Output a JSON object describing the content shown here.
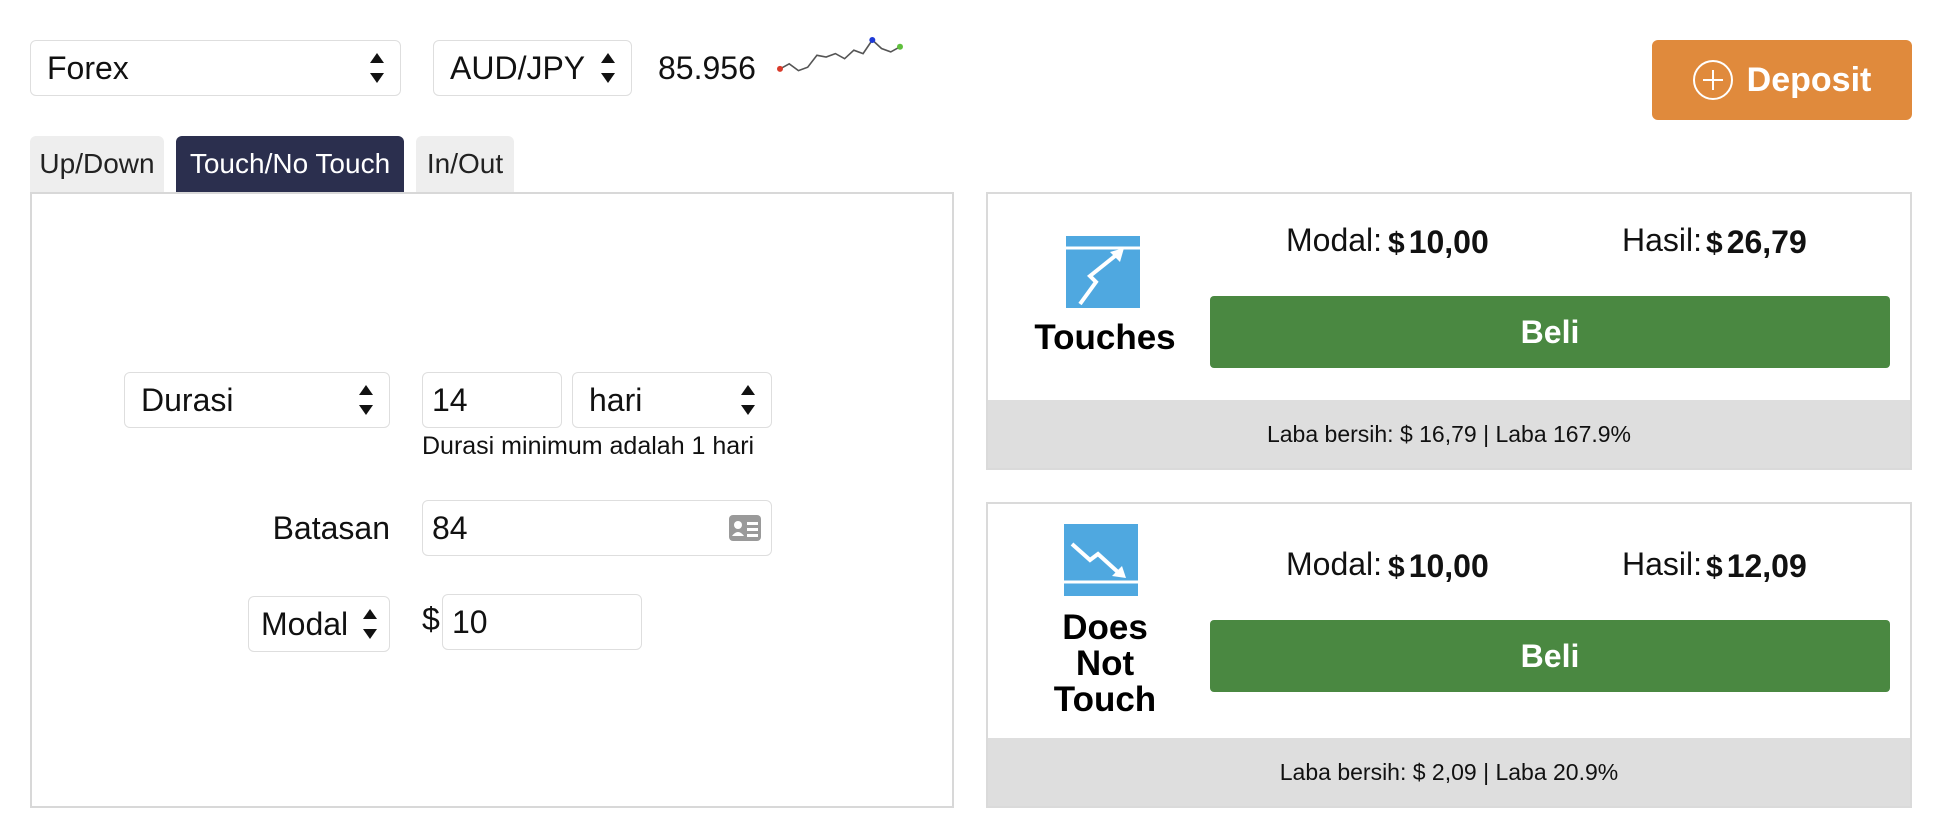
{
  "top": {
    "market_select": "Forex",
    "symbol_select": "AUD/JPY",
    "price": "85.956",
    "deposit_label": "Deposit",
    "sparkline": {
      "points": [
        0.15,
        0.3,
        0.1,
        0.2,
        0.55,
        0.5,
        0.6,
        0.45,
        0.7,
        0.6,
        1.0,
        0.75,
        0.65,
        0.8
      ],
      "start_color": "#d93b2b",
      "peak_color": "#1e3ad6",
      "end_color": "#5fbf3c"
    }
  },
  "tabs": [
    {
      "label": "Up/Down",
      "active": false
    },
    {
      "label": "Touch/No Touch",
      "active": true
    },
    {
      "label": "In/Out",
      "active": false
    }
  ],
  "form": {
    "duration_select": "Durasi",
    "duration_value": "14",
    "duration_unit": "hari",
    "duration_hint": "Durasi minimum adalah 1 hari",
    "barrier_label": "Batasan",
    "barrier_value": "84",
    "stake_select": "Modal",
    "currency_symbol": "$",
    "stake_value": "10"
  },
  "contracts": [
    {
      "title": "Touches",
      "stake_label": "Modal:",
      "stake_currency": "$",
      "stake_amount": "10,00",
      "payout_label": "Hasil:",
      "payout_currency": "$",
      "payout_amount": "26,79",
      "button": "Beli",
      "footer": "Laba bersih: $ 16,79 | Laba 167.9%"
    },
    {
      "title_line1": "Does",
      "title_line2": "Not",
      "title_line3": "Touch",
      "stake_label": "Modal:",
      "stake_currency": "$",
      "stake_amount": "10,00",
      "payout_label": "Hasil:",
      "payout_currency": "$",
      "payout_amount": "12,09",
      "button": "Beli",
      "footer": "Laba bersih: $ 2,09 | Laba 20.9%"
    }
  ],
  "colors": {
    "accent_tab": "#2b2f4e",
    "deposit": "#e08a3c",
    "buy": "#4a8841",
    "icon_blue": "#4fa8e0"
  }
}
